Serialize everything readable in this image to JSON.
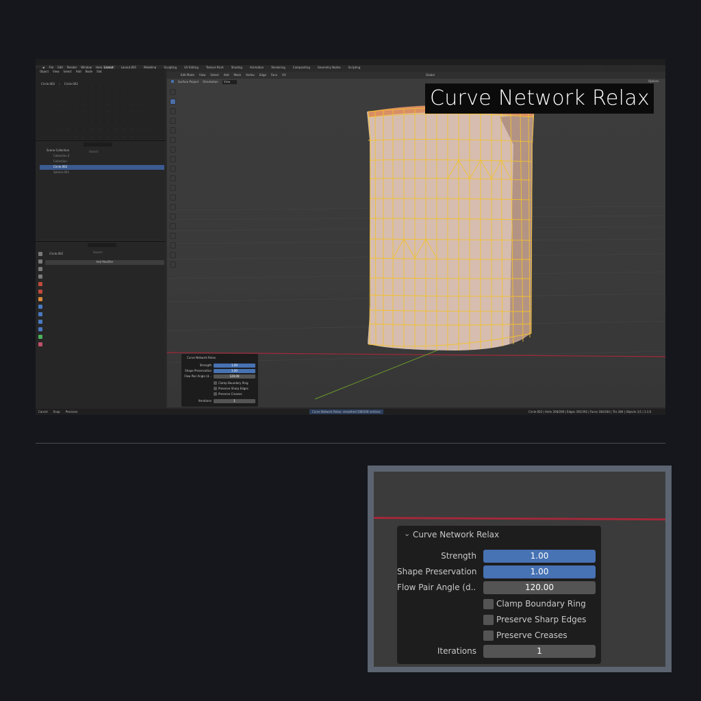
{
  "title_overlay": "Curve Network Relax",
  "blender": {
    "menu": [
      "File",
      "Edit",
      "Render",
      "Window",
      "Help"
    ],
    "workspaces": [
      "Layout",
      "Layout.001",
      "Modeling",
      "Sculpting",
      "UV Editing",
      "Texture Paint",
      "Shading",
      "Animation",
      "Rendering",
      "Compositing",
      "Geometry Nodes",
      "Scripting"
    ],
    "active_workspace": "Layout",
    "scene": "Scene",
    "view_layer": "ViewLayer",
    "node_header": [
      "Object",
      "View",
      "Select",
      "Add",
      "Node"
    ],
    "node_header_field": "Slot",
    "breadcrumb": [
      "Circle.002",
      "Circle.002"
    ],
    "outliner_search_placeholder": "Search",
    "outliner_items": [
      "Scene Collection",
      "Collection.2",
      "Collection",
      "Circle.002",
      "Sphere.001"
    ],
    "properties_search_placeholder": "Search",
    "properties_object": "Circle.002",
    "add_modifier": "Add Modifier",
    "viewport_header": [
      "Edit Mode",
      "View",
      "Select",
      "Add",
      "Mesh",
      "Vertex",
      "Edge",
      "Face",
      "UV"
    ],
    "transform_orientation": "Global",
    "surface_project": "Surface Project",
    "orientation_label": "Orientation",
    "orientation_value": "View",
    "options": "Options",
    "status_left": [
      "Cancel",
      "Snap",
      "Precision"
    ],
    "status_center": "Curve Network Relax: smoothed 208/208 vertices",
    "status_right": "Circle.002 | Verts 208/208 | Edges 392/392 | Faces 184/184 | Tris 384 | Objects 1/1 | 3.3.0"
  },
  "operator_panel": {
    "title": "Curve Network Relax",
    "strength_label": "Strength",
    "strength_value": "1.00",
    "shape_label": "Shape Preservation",
    "shape_value": "1.00",
    "flow_label": "Flow Pair Angle (d...",
    "flow_value": "120.00",
    "clamp_label": "Clamp Boundary Ring",
    "sharp_label": "Preserve Sharp Edges",
    "creases_label": "Preserve Creases",
    "iterations_label": "Iterations",
    "iterations_value": "1"
  },
  "colors": {
    "accent_blue": "#4772b3",
    "selection_yellow": "#f2c12e",
    "mesh_face": "#d9c0b2",
    "x_axis_red": "#a3283a",
    "y_axis_green": "#6a9a2c"
  },
  "icons": [
    "cursor-icon",
    "select-box-icon",
    "move-icon",
    "rotate-icon",
    "scale-icon",
    "transform-icon",
    "annotate-icon",
    "measure-icon",
    "add-cube-icon",
    "extrude-icon",
    "inset-icon",
    "bevel-icon",
    "loopcut-icon",
    "knife-icon",
    "polybuild-icon",
    "spin-icon",
    "smooth-icon",
    "edge-slide-icon",
    "shrink-icon",
    "shear-icon",
    "rip-icon",
    "zoom-icon",
    "hand-icon",
    "camera-icon",
    "grid-icon"
  ]
}
